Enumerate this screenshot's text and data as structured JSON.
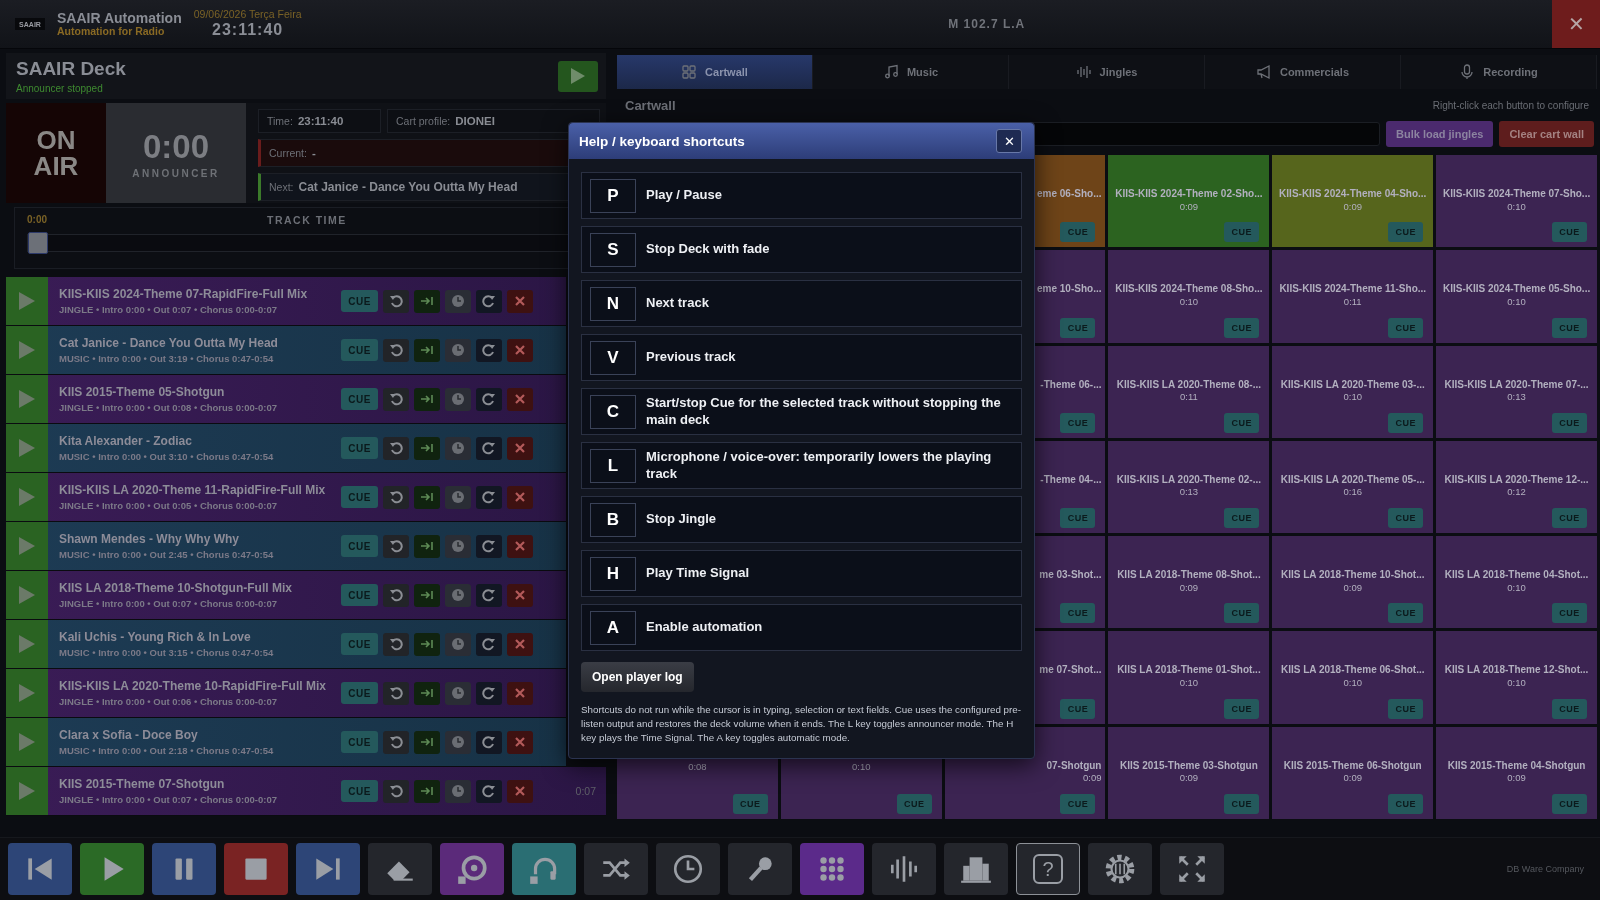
{
  "header": {
    "logo": "SAAIR",
    "title": "SAAIR Automation",
    "subtitle": "Automation for Radio",
    "date": "09/06/2026 Terça Feira",
    "clock": "23:11:40",
    "station": "M 102.7 L.A",
    "close": "✕"
  },
  "deck": {
    "title": "SAAIR Deck",
    "status": "Announcer stopped",
    "on_air": "ON AIR",
    "timer": "0:00",
    "mode": "ANNOUNCER",
    "info": {
      "time_label": "Time:",
      "time": "23:11:40",
      "profile_label": "Cart profile:",
      "profile": "DIONEI",
      "current_label": "Current:",
      "current": "-",
      "next_label": "Next:",
      "next": "Cat Janice - Dance You Outta My Head"
    },
    "track": {
      "elapsed": "0:00",
      "label": "TRACK TIME",
      "level": 0
    }
  },
  "playlist": [
    {
      "kind": "jingle",
      "title": "KIIS-KIIS 2024-Theme 07-RapidFire-Full Mix",
      "meta": "JINGLE • Intro 0:00 • Out 0:07 • Chorus 0:00-0:07",
      "cue": "CUE"
    },
    {
      "kind": "music",
      "title": "Cat Janice - Dance You Outta My Head",
      "meta": "MUSIC • Intro 0:00 • Out 3:19 • Chorus 0:47-0:54",
      "cue": "CUE"
    },
    {
      "kind": "jingle",
      "title": "KIIS 2015-Theme 05-Shotgun",
      "meta": "JINGLE • Intro 0:00 • Out 0:08 • Chorus 0:00-0:07",
      "cue": "CUE"
    },
    {
      "kind": "music",
      "title": "Kita Alexander - Zodiac",
      "meta": "MUSIC • Intro 0:00 • Out 3:10 • Chorus 0:47-0:54",
      "cue": "CUE"
    },
    {
      "kind": "jingle",
      "title": "KIIS-KIIS LA 2020-Theme 11-RapidFire-Full Mix",
      "meta": "JINGLE • Intro 0:00 • Out 0:05 • Chorus 0:00-0:07",
      "cue": "CUE"
    },
    {
      "kind": "music",
      "title": "Shawn Mendes - Why Why Why",
      "meta": "MUSIC • Intro 0:00 • Out 2:45 • Chorus 0:47-0:54",
      "cue": "CUE"
    },
    {
      "kind": "jingle",
      "title": "KIIS LA 2018-Theme 10-Shotgun-Full Mix",
      "meta": "JINGLE • Intro 0:00 • Out 0:07 • Chorus 0:00-0:07",
      "cue": "CUE"
    },
    {
      "kind": "music",
      "title": "Kali Uchis - Young Rich & In Love",
      "meta": "MUSIC • Intro 0:00 • Out 3:15 • Chorus 0:47-0:54",
      "cue": "CUE"
    },
    {
      "kind": "jingle",
      "title": "KIIS-KIIS LA 2020-Theme 10-RapidFire-Full Mix",
      "meta": "JINGLE • Intro 0:00 • Out 0:06 • Chorus 0:00-0:07",
      "cue": "CUE"
    },
    {
      "kind": "music",
      "title": "Clara x Sofia - Doce Boy",
      "meta": "MUSIC • Intro 0:00 • Out 2:18 • Chorus 0:47-0:54",
      "cue": "CUE"
    },
    {
      "kind": "jingle",
      "title": "KIIS 2015-Theme 07-Shotgun",
      "meta": "JINGLE • Intro 0:00 • Out 0:07 • Chorus 0:00-0:07",
      "cue": "CUE",
      "remaining": "0:07"
    }
  ],
  "cartwall": {
    "tabs": [
      {
        "kind": "grid",
        "label": "Cartwall",
        "selected": true
      },
      {
        "kind": "music",
        "label": "Music",
        "selected": false
      },
      {
        "kind": "wave",
        "label": "Jingles",
        "selected": false
      },
      {
        "kind": "megaphone",
        "label": "Commercials",
        "selected": false
      },
      {
        "kind": "mic",
        "label": "Recording",
        "selected": false
      }
    ],
    "heading": "Cartwall",
    "hint": "Right-click each button to configure",
    "bulk": "Bulk load jingles",
    "clear": "Clear cart wall",
    "rows": [
      {
        "tiles": [
          {
            "title": "eme 06-Sho...",
            "cut": true,
            "cue": "CUE",
            "color": "#6e4418"
          },
          {
            "title": "KIIS-KIIS 2024-Theme 02-Sho...",
            "duration": "0:09",
            "cue": "CUE",
            "color": "#2c6320"
          },
          {
            "title": "KIIS-KIIS 2024-Theme 04-Sho...",
            "duration": "0:09",
            "cue": "CUE",
            "color": "#56651c"
          },
          {
            "title": "KIIS-KIIS 2024-Theme 07-Sho...",
            "duration": "0:10",
            "cue": "CUE",
            "color": "#3c2452"
          }
        ]
      },
      {
        "tiles": [
          {
            "title": "eme 10-Sho...",
            "cut": true,
            "cue": "CUE",
            "color": "#3c2452"
          },
          {
            "title": "KIIS-KIIS 2024-Theme 08-Sho...",
            "duration": "0:10",
            "cue": "CUE",
            "color": "#3c2452"
          },
          {
            "title": "KIIS-KIIS 2024-Theme 11-Sho...",
            "duration": "0:11",
            "cue": "CUE",
            "color": "#3c2452"
          },
          {
            "title": "KIIS-KIIS 2024-Theme 05-Sho...",
            "duration": "0:10",
            "cue": "CUE",
            "color": "#3c2452"
          }
        ]
      },
      {
        "tiles": [
          {
            "title": "-Theme 06-...",
            "cut": true,
            "cue": "CUE",
            "color": "#3c2452"
          },
          {
            "title": "KIIS-KIIS LA 2020-Theme 08-...",
            "duration": "0:11",
            "cue": "CUE",
            "color": "#3c2452"
          },
          {
            "title": "KIIS-KIIS LA 2020-Theme 03-...",
            "duration": "0:10",
            "cue": "CUE",
            "color": "#3c2452"
          },
          {
            "title": "KIIS-KIIS LA 2020-Theme 07-...",
            "duration": "0:13",
            "cue": "CUE",
            "color": "#3c2452"
          }
        ]
      },
      {
        "tiles": [
          {
            "title": "-Theme 04-...",
            "cut": true,
            "cue": "CUE",
            "color": "#3c2452"
          },
          {
            "title": "KIIS-KIIS LA 2020-Theme 02-...",
            "duration": "0:13",
            "cue": "CUE",
            "color": "#3c2452"
          },
          {
            "title": "KIIS-KIIS LA 2020-Theme 05-...",
            "duration": "0:16",
            "cue": "CUE",
            "color": "#3c2452"
          },
          {
            "title": "KIIS-KIIS LA 2020-Theme 12-...",
            "duration": "0:12",
            "cue": "CUE",
            "color": "#3c2452"
          }
        ]
      },
      {
        "tiles": [
          {
            "title": "me 03-Shot...",
            "cut": true,
            "cue": "CUE",
            "color": "#3c2452"
          },
          {
            "title": "KIIS LA 2018-Theme 08-Shot...",
            "duration": "0:09",
            "cue": "CUE",
            "color": "#3c2452"
          },
          {
            "title": "KIIS LA 2018-Theme 10-Shot...",
            "duration": "0:09",
            "cue": "CUE",
            "color": "#3c2452"
          },
          {
            "title": "KIIS LA 2018-Theme 04-Shot...",
            "duration": "0:10",
            "cue": "CUE",
            "color": "#3c2452"
          }
        ]
      },
      {
        "tiles": [
          {
            "title": "me 07-Shot...",
            "cut": true,
            "cue": "CUE",
            "color": "#3c2452"
          },
          {
            "title": "KIIS LA 2018-Theme 01-Shot...",
            "duration": "0:10",
            "cue": "CUE",
            "color": "#3c2452"
          },
          {
            "title": "KIIS LA 2018-Theme 06-Shot...",
            "duration": "0:10",
            "cue": "CUE",
            "color": "#3c2452"
          },
          {
            "title": "KIIS LA 2018-Theme 12-Shot...",
            "duration": "0:10",
            "cue": "CUE",
            "color": "#3c2452"
          }
        ]
      },
      {
        "tiles": [
          {
            "duration": "0:08",
            "cue": "CUE",
            "color": "#3c2452"
          },
          {
            "duration": "0:10",
            "cue": "CUE",
            "color": "#3c2452"
          },
          {
            "title": "07-Shotgun",
            "duration": "0:09",
            "cut": true,
            "cue": "CUE",
            "color": "#3c2452"
          },
          {
            "title": "KIIS 2015-Theme 03-Shotgun",
            "duration": "0:09",
            "cue": "CUE",
            "color": "#3c2452"
          },
          {
            "title": "KIIS 2015-Theme 06-Shotgun",
            "duration": "0:09",
            "cue": "CUE",
            "color": "#3c2452"
          },
          {
            "title": "KIIS 2015-Theme 04-Shotgun",
            "duration": "0:09",
            "cue": "CUE",
            "color": "#3c2452"
          }
        ]
      }
    ]
  },
  "modal": {
    "title": "Help / keyboard shortcuts",
    "close": "✕",
    "shortcuts": [
      {
        "key": "P",
        "action": "Play / Pause"
      },
      {
        "key": "S",
        "action": "Stop Deck with fade"
      },
      {
        "key": "N",
        "action": "Next track"
      },
      {
        "key": "V",
        "action": "Previous track"
      },
      {
        "key": "C",
        "action": "Start/stop Cue for the selected track without stopping the main deck"
      },
      {
        "key": "L",
        "action": "Microphone / voice-over: temporarily lowers the playing track"
      },
      {
        "key": "B",
        "action": "Stop Jingle"
      },
      {
        "key": "H",
        "action": "Play Time Signal"
      },
      {
        "key": "A",
        "action": "Enable automation"
      }
    ],
    "log_button": "Open player log",
    "note": "Shortcuts do not run while the cursor is in typing, selection or text fields. Cue uses the configured pre-listen output and restores the deck volume when it ends. The L key toggles announcer mode. The H key plays the Time Signal. The A key toggles automatic mode."
  },
  "toolbar": {
    "buttons": [
      {
        "kind": "prev",
        "color": "#2d4577",
        "selected": false
      },
      {
        "kind": "play",
        "color": "#2b6a26",
        "selected": false
      },
      {
        "kind": "pause",
        "color": "#2d4577",
        "selected": false
      },
      {
        "kind": "stop",
        "color": "#7a2323",
        "selected": false
      },
      {
        "kind": "next",
        "color": "#2d4577",
        "selected": false
      },
      {
        "kind": "eraser",
        "color": "#24262c",
        "selected": false
      },
      {
        "kind": "disc",
        "color": "#5b2a7a",
        "selected": false
      },
      {
        "kind": "headphones",
        "color": "#2a6e73",
        "selected": false
      },
      {
        "kind": "shuffle",
        "color": "#24262c",
        "selected": false
      },
      {
        "kind": "clock",
        "color": "#24262c",
        "selected": false
      },
      {
        "kind": "mic",
        "color": "#24262c",
        "selected": false
      },
      {
        "kind": "grid",
        "color": "#5b2a8a",
        "selected": false
      },
      {
        "kind": "wave",
        "color": "#24262c",
        "selected": false
      },
      {
        "kind": "building",
        "color": "#24262c",
        "selected": false
      },
      {
        "kind": "help",
        "glyph": "?",
        "color": "#24262c",
        "selected": true
      },
      {
        "kind": "gear",
        "color": "#24262c",
        "selected": false
      },
      {
        "kind": "fullscreen",
        "color": "#24262c",
        "selected": false
      }
    ],
    "credit": "DB Ware Company"
  }
}
